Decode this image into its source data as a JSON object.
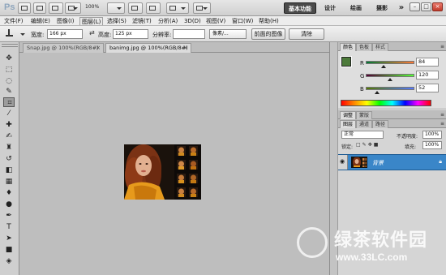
{
  "appbar": {
    "logo": "Ps",
    "zoom": "100%",
    "workspaces": [
      "基本功能",
      "设计",
      "绘画",
      "摄影"
    ],
    "overflow": "»"
  },
  "menu": [
    "文件(F)",
    "编辑(E)",
    "图像(I)",
    "图层(L)",
    "选择(S)",
    "滤镜(T)",
    "分析(A)",
    "3D(D)",
    "视图(V)",
    "窗口(W)",
    "帮助(H)"
  ],
  "options": {
    "width_label": "宽度:",
    "width_value": "166 px",
    "height_label": "高度:",
    "height_value": "125 px",
    "resolution_label": "分辨率:",
    "resolution_value": "",
    "unit_value": "像素/...",
    "front_image_button": "前面的图像",
    "clear_button": "清除"
  },
  "document_tabs": [
    {
      "label": "Snap.jpg @ 100%(RGB/8#)",
      "close": "×"
    },
    {
      "label": "banimg.jpg @ 100%(RGB/8#)",
      "close": "×"
    }
  ],
  "color_panel": {
    "tabs": [
      "颜色",
      "色板",
      "样式"
    ],
    "fg_color": "#4c7a3a",
    "channels": [
      {
        "label": "R",
        "value": "84"
      },
      {
        "label": "G",
        "value": "120"
      },
      {
        "label": "B",
        "value": "52"
      }
    ]
  },
  "adjust_tabs": [
    "调整",
    "蒙版"
  ],
  "layers_panel": {
    "tabs": [
      "图层",
      "通道",
      "路径"
    ],
    "blend_mode": "正常",
    "opacity_label": "不透明度:",
    "opacity_value": "100%",
    "lock_label": "锁定:",
    "fill_label": "填充:",
    "fill_value": "100%",
    "layer_name": "背景"
  },
  "watermark": {
    "brand": "绿茶软件园",
    "url": "www.33LC.com"
  }
}
